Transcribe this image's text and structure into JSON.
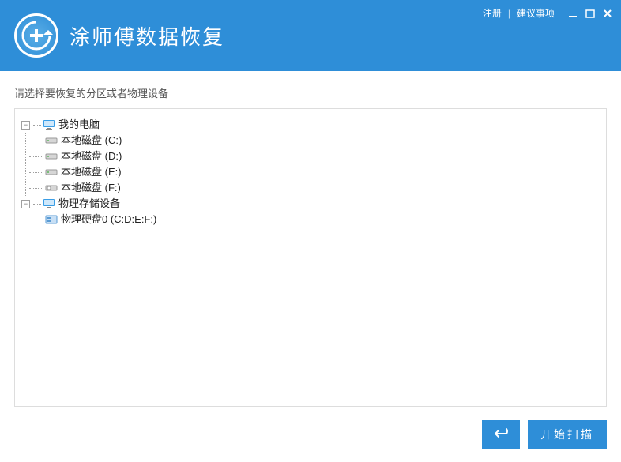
{
  "top_links": {
    "register": "注册",
    "suggestion": "建议事项"
  },
  "app": {
    "title": "涂师傅数据恢复"
  },
  "instruction": "请选择要恢复的分区或者物理设备",
  "tree": {
    "my_computer": {
      "label": "我的电脑",
      "drives": [
        {
          "label": "本地磁盘  (C:)"
        },
        {
          "label": "本地磁盘  (D:)"
        },
        {
          "label": "本地磁盘  (E:)"
        },
        {
          "label": "本地磁盘  (F:)"
        }
      ]
    },
    "physical": {
      "label": "物理存储设备",
      "disks": [
        {
          "label": "物理硬盘0   (C:D:E:F:)"
        }
      ]
    }
  },
  "buttons": {
    "scan": "开始扫描"
  }
}
